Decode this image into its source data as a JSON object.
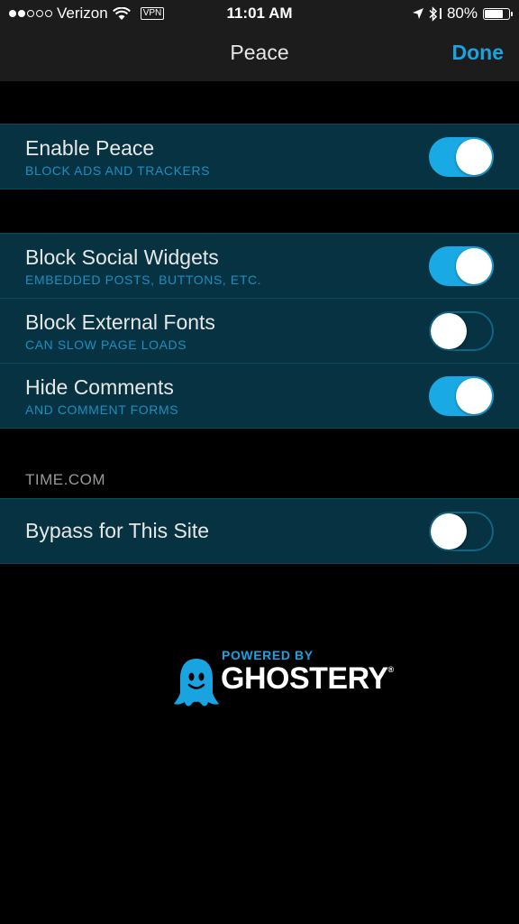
{
  "status_bar": {
    "carrier": "Verizon",
    "signal_bars_filled": 2,
    "signal_bars_total": 5,
    "vpn_label": "VPN",
    "time": "11:01 AM",
    "battery_percent": "80%",
    "battery_level": 0.8
  },
  "nav": {
    "title": "Peace",
    "done_label": "Done"
  },
  "groups": {
    "main": {
      "enable_peace": {
        "label": "Enable Peace",
        "sub": "BLOCK ADS AND TRACKERS",
        "on": true
      }
    },
    "options": {
      "social": {
        "label": "Block Social Widgets",
        "sub": "EMBEDDED POSTS, BUTTONS, ETC.",
        "on": true
      },
      "fonts": {
        "label": "Block External Fonts",
        "sub": "CAN SLOW PAGE LOADS",
        "on": false
      },
      "comments": {
        "label": "Hide Comments",
        "sub": "AND COMMENT FORMS",
        "on": true
      }
    },
    "site": {
      "header": "TIME.COM",
      "bypass": {
        "label": "Bypass for This Site",
        "on": false
      }
    }
  },
  "footer": {
    "powered_by": "POWERED BY",
    "brand": "GHOSTERY",
    "registered": "®"
  },
  "colors": {
    "accent": "#19a3e0",
    "toggle_on": "#19aae5",
    "row_bg": "#063241",
    "subtitle": "#1b8fc3"
  },
  "icons": [
    "wifi-icon",
    "location-arrow-icon",
    "bluetooth-icon",
    "battery-icon",
    "ghost-logo-icon"
  ]
}
